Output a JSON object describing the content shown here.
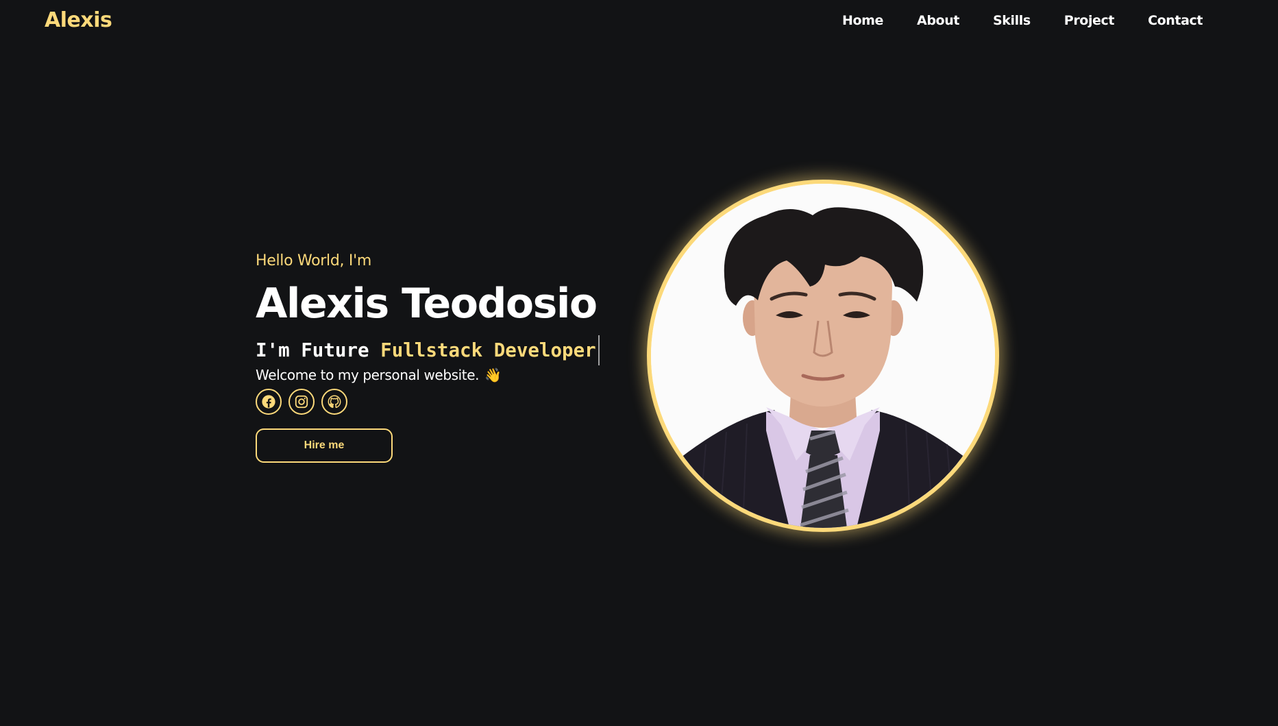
{
  "brand": {
    "logo": "Alexis"
  },
  "nav": {
    "items": [
      {
        "label": "Home"
      },
      {
        "label": "About"
      },
      {
        "label": "Skills"
      },
      {
        "label": "Project"
      },
      {
        "label": "Contact"
      }
    ]
  },
  "hero": {
    "greeting": "Hello World, I'm",
    "name": "Alexis Teodosio",
    "typing_prefix": "I'm Future",
    "typing_role": "Fullstack Developer",
    "welcome": "Welcome to my personal website.",
    "welcome_emoji": "👋",
    "socials": [
      {
        "icon": "facebook-icon"
      },
      {
        "icon": "instagram-icon"
      },
      {
        "icon": "github-icon"
      }
    ],
    "cta_label": "Hire me"
  },
  "colors": {
    "background": "#121315",
    "accent": "#fcd97a",
    "text": "#ffffff"
  }
}
